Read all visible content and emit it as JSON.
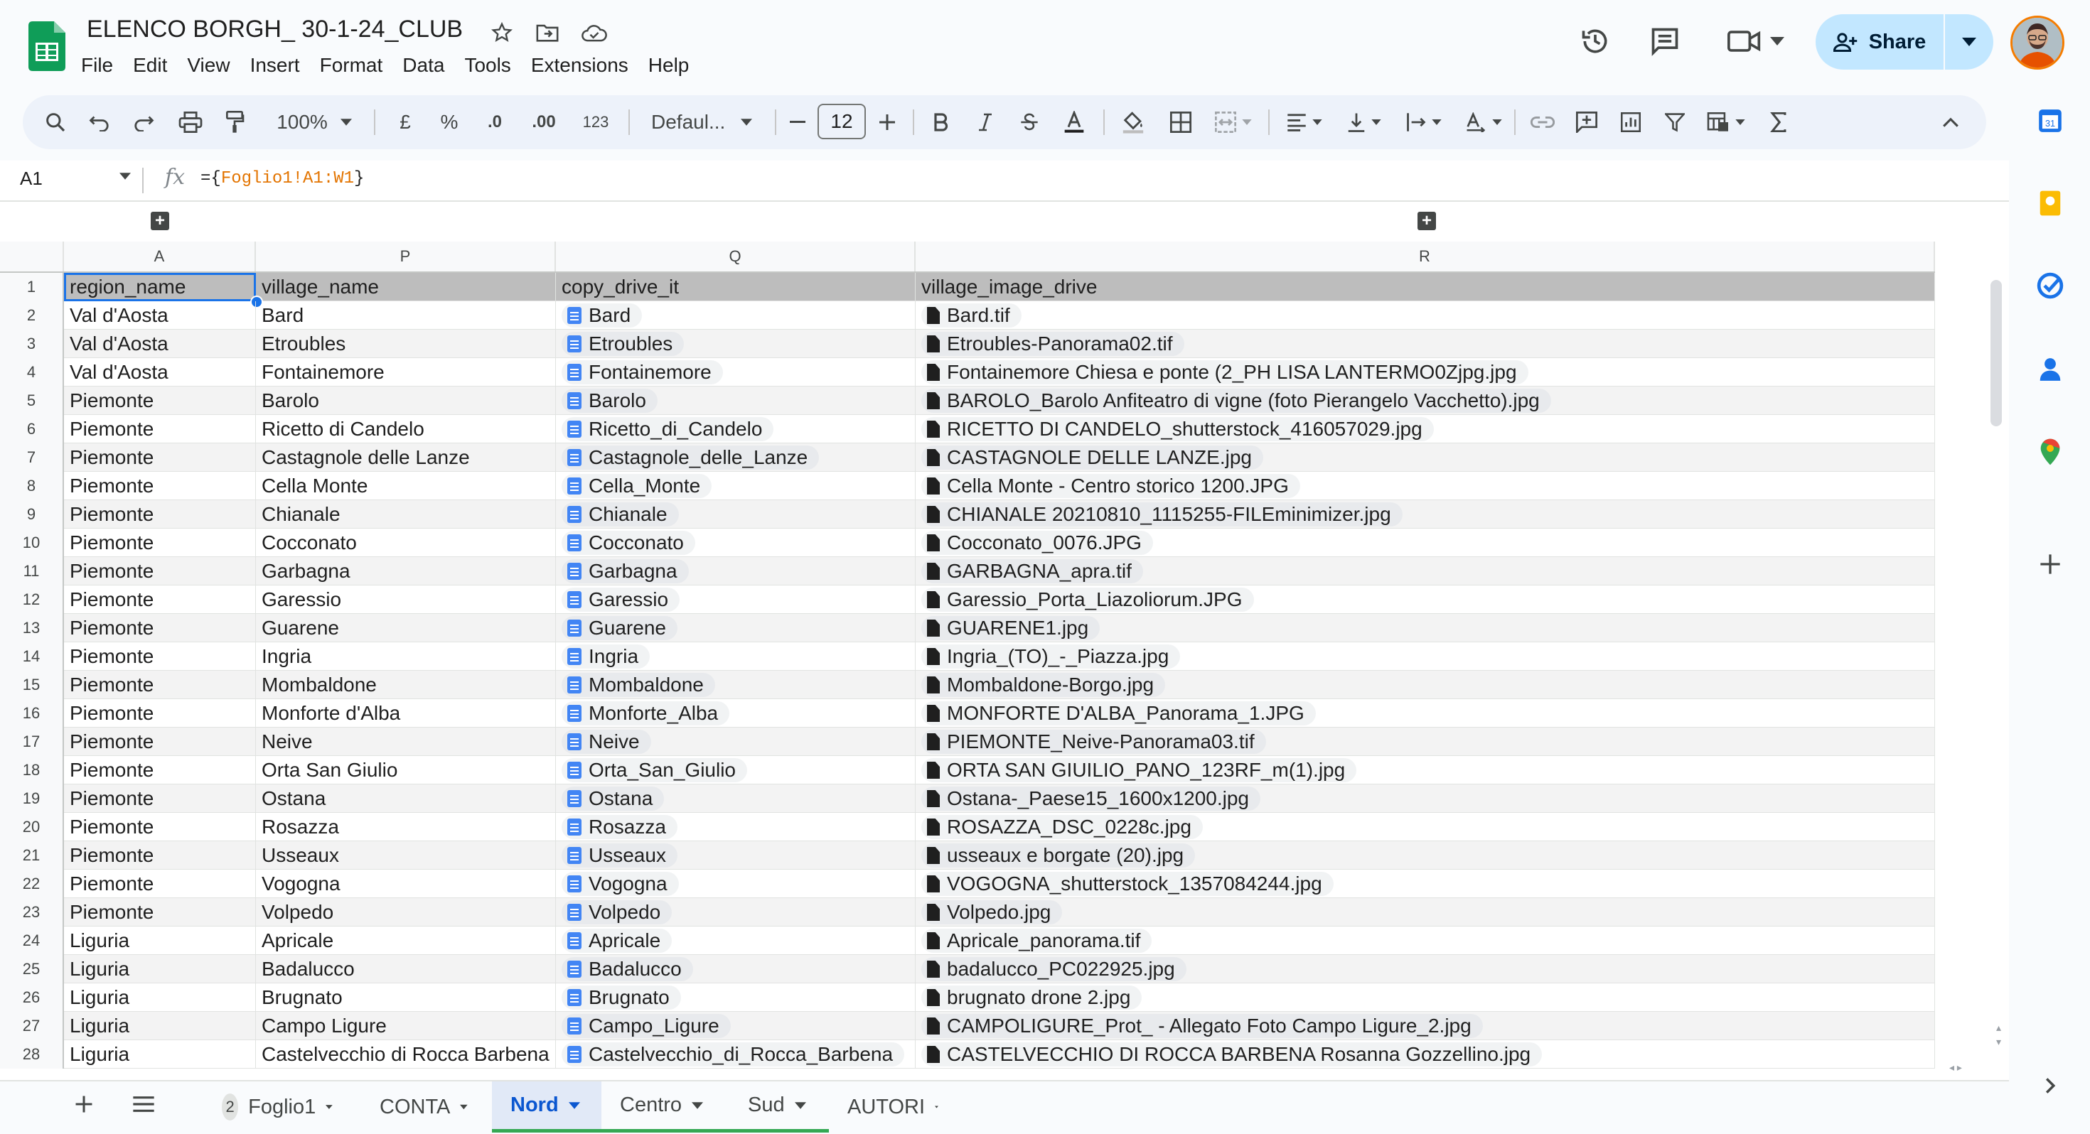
{
  "header": {
    "title": "ELENCO BORGH_ 30-1-24_CLUB",
    "menu": [
      "File",
      "Edit",
      "View",
      "Insert",
      "Format",
      "Data",
      "Tools",
      "Extensions",
      "Help"
    ],
    "share_label": "Share"
  },
  "toolbar": {
    "zoom": "100%",
    "currency": "£",
    "percent": "%",
    "dec_decrease": ".0",
    "dec_increase": ".00",
    "number_format": "123",
    "font": "Defaul...",
    "font_size": "12"
  },
  "formula_bar": {
    "cell_ref": "A1",
    "fx": "fx",
    "formula": "={Foglio1!A1:W1}"
  },
  "columns": [
    "A",
    "P",
    "Q",
    "R"
  ],
  "rows": [
    {
      "n": "1",
      "region": "region_name",
      "village": "village_name",
      "copy": "copy_drive_it",
      "image": "village_image_drive"
    },
    {
      "n": "2",
      "region": "Val d'Aosta",
      "village": "Bard",
      "copy": "Bard",
      "image": "Bard.tif"
    },
    {
      "n": "3",
      "region": "Val d'Aosta",
      "village": "Etroubles",
      "copy": "Etroubles",
      "image": "Etroubles-Panorama02.tif"
    },
    {
      "n": "4",
      "region": "Val d'Aosta",
      "village": "Fontainemore",
      "copy": "Fontainemore",
      "image": "Fontainemore Chiesa e ponte (2_PH LISA LANTERMO0Zjpg.jpg"
    },
    {
      "n": "5",
      "region": "Piemonte",
      "village": "Barolo",
      "copy": "Barolo",
      "image": "BAROLO_Barolo Anfiteatro di vigne (foto Pierangelo Vacchetto).jpg"
    },
    {
      "n": "6",
      "region": "Piemonte",
      "village": "Ricetto di Candelo",
      "copy": "Ricetto_di_Candelo",
      "image": "RICETTO DI CANDELO_shutterstock_416057029.jpg"
    },
    {
      "n": "7",
      "region": "Piemonte",
      "village": "Castagnole delle Lanze",
      "copy": "Castagnole_delle_Lanze",
      "image": "CASTAGNOLE DELLE LANZE.jpg"
    },
    {
      "n": "8",
      "region": "Piemonte",
      "village": "Cella Monte",
      "copy": "Cella_Monte",
      "image": "Cella Monte - Centro storico 1200.JPG"
    },
    {
      "n": "9",
      "region": "Piemonte",
      "village": "Chianale",
      "copy": "Chianale",
      "image": "CHIANALE 20210810_1115255-FILEminimizer.jpg"
    },
    {
      "n": "10",
      "region": "Piemonte",
      "village": "Cocconato",
      "copy": "Cocconato",
      "image": "Cocconato_0076.JPG"
    },
    {
      "n": "11",
      "region": "Piemonte",
      "village": "Garbagna",
      "copy": "Garbagna",
      "image": "GARBAGNA_apra.tif"
    },
    {
      "n": "12",
      "region": "Piemonte",
      "village": "Garessio",
      "copy": "Garessio",
      "image": "Garessio_Porta_Liazoliorum.JPG"
    },
    {
      "n": "13",
      "region": "Piemonte",
      "village": "Guarene",
      "copy": "Guarene",
      "image": "GUARENE1.jpg"
    },
    {
      "n": "14",
      "region": "Piemonte",
      "village": "Ingria",
      "copy": "Ingria",
      "image": "Ingria_(TO)_-_Piazza.jpg"
    },
    {
      "n": "15",
      "region": "Piemonte",
      "village": "Mombaldone",
      "copy": "Mombaldone",
      "image": "Mombaldone-Borgo.jpg"
    },
    {
      "n": "16",
      "region": "Piemonte",
      "village": "Monforte d'Alba",
      "copy": "Monforte_Alba",
      "image": "MONFORTE D'ALBA_Panorama_1.JPG"
    },
    {
      "n": "17",
      "region": "Piemonte",
      "village": "Neive",
      "copy": "Neive",
      "image": "PIEMONTE_Neive-Panorama03.tif"
    },
    {
      "n": "18",
      "region": "Piemonte",
      "village": "Orta San Giulio",
      "copy": "Orta_San_Giulio",
      "image": "ORTA SAN GIUILIO_PANO_123RF_m(1).jpg"
    },
    {
      "n": "19",
      "region": "Piemonte",
      "village": "Ostana",
      "copy": "Ostana",
      "image": "Ostana-_Paese15_1600x1200.jpg"
    },
    {
      "n": "20",
      "region": "Piemonte",
      "village": "Rosazza",
      "copy": "Rosazza",
      "image": "ROSAZZA_DSC_0228c.jpg"
    },
    {
      "n": "21",
      "region": "Piemonte",
      "village": "Usseaux",
      "copy": "Usseaux",
      "image": "usseaux e borgate (20).jpg"
    },
    {
      "n": "22",
      "region": "Piemonte",
      "village": "Vogogna",
      "copy": "Vogogna",
      "image": "VOGOGNA_shutterstock_1357084244.jpg"
    },
    {
      "n": "23",
      "region": "Piemonte",
      "village": "Volpedo",
      "copy": "Volpedo",
      "image": "Volpedo.jpg"
    },
    {
      "n": "24",
      "region": "Liguria",
      "village": "Apricale",
      "copy": "Apricale",
      "image": "Apricale_panorama.tif"
    },
    {
      "n": "25",
      "region": "Liguria",
      "village": "Badalucco",
      "copy": "Badalucco",
      "image": "badalucco_PC022925.jpg"
    },
    {
      "n": "26",
      "region": "Liguria",
      "village": "Brugnato",
      "copy": "Brugnato",
      "image": "brugnato drone 2.jpg"
    },
    {
      "n": "27",
      "region": "Liguria",
      "village": "Campo Ligure",
      "copy": "Campo_Ligure",
      "image": "CAMPOLIGURE_Prot_ - Allegato Foto Campo Ligure_2.jpg"
    },
    {
      "n": "28",
      "region": "Liguria",
      "village": "Castelvecchio di Rocca Barbena",
      "copy": "Castelvecchio_di_Rocca_Barbena",
      "image": "CASTELVECCHIO DI ROCCA BARBENA Rosanna Gozzellino.jpg"
    }
  ],
  "sheet_tabs": [
    {
      "label": "Foglio1",
      "badge": "2"
    },
    {
      "label": "CONTA"
    },
    {
      "label": "Nord",
      "active": true
    },
    {
      "label": "Centro"
    },
    {
      "label": "Sud"
    },
    {
      "label": "AUTORI"
    }
  ],
  "colors": {
    "accent": "#0b57d0",
    "share_bg": "#c2e7ff",
    "tab_highlight": "#34a853",
    "header_row_bg": "#bdbdbd",
    "selection": "#1a73e8"
  },
  "icons": {
    "side_panel": [
      "calendar-icon",
      "keep-icon",
      "tasks-icon",
      "contacts-icon",
      "maps-icon",
      "add-icon",
      "expand-icon"
    ]
  }
}
